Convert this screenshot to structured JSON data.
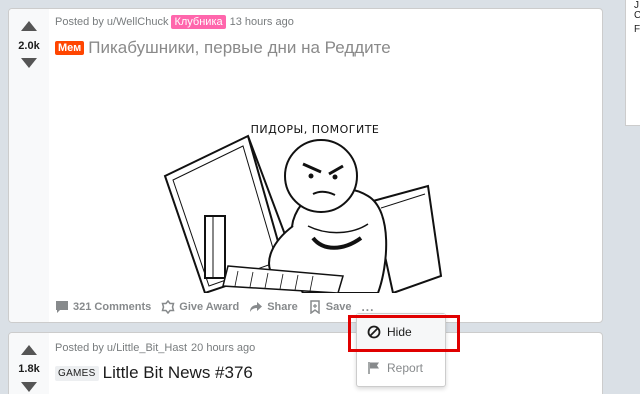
{
  "posts": [
    {
      "score": "2.0k",
      "posted_by_prefix": "Posted by",
      "author": "u/WellChuck",
      "user_flair": "Клубника",
      "time": "13 hours ago",
      "post_flair": "Мем",
      "title": "Пикабушники, первые дни на Реддите",
      "image_caption": "ПИДОРЫ, ПОМОГИТЕ",
      "actions": {
        "comments": "321 Comments",
        "award": "Give Award",
        "share": "Share",
        "save": "Save",
        "more": "..."
      }
    },
    {
      "score": "1.8k",
      "posted_by_prefix": "Posted by",
      "author": "u/Little_Bit_Hast",
      "time": "20 hours ago",
      "post_flair": "GAMES",
      "title": "Little Bit News #376"
    }
  ],
  "menu": {
    "hide": "Hide",
    "report": "Report"
  },
  "sidebar_fragment": [
    "J",
    "C",
    "F"
  ],
  "colors": {
    "user_flair": "#ff66ac",
    "post_flair": "#ff4500",
    "highlight": "#e00000",
    "background": "#dae0e6"
  }
}
